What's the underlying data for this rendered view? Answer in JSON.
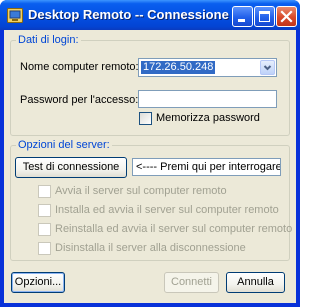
{
  "window": {
    "title": "Desktop Remoto -- Connessione",
    "app_icon": "remote-desktop-icon",
    "controls": [
      "minimize-icon",
      "maximize-icon",
      "close-icon"
    ]
  },
  "login": {
    "legend": "Dati di login:",
    "computer_label": "Nome computer remoto:",
    "computer_value": "172.26.50.248",
    "password_label": "Password per l'accesso:",
    "password_value": "",
    "remember_label": "Memorizza password",
    "remember_checked": false
  },
  "server": {
    "legend": "Opzioni del server:",
    "test_button": "Test di connessione",
    "hint_text": "<---- Premi qui per interrogare il server",
    "options": [
      {
        "label": "Avvia il server sul computer remoto",
        "checked": false,
        "enabled": false
      },
      {
        "label": "Installa ed avvia il server sul computer remoto",
        "checked": false,
        "enabled": false
      },
      {
        "label": "Reinstalla ed avvia il server sul computer remoto",
        "checked": false,
        "enabled": false
      },
      {
        "label": "Disinstalla il server alla disconnessione",
        "checked": false,
        "enabled": false
      }
    ]
  },
  "footer": {
    "options_button": "Opzioni...",
    "connect_button": "Connetti",
    "cancel_button": "Annulla"
  },
  "colors": {
    "titlebar": "#0451e3",
    "dialog_bg": "#ece9d8",
    "group_legend": "#0046d5",
    "selection": "#316ac5",
    "disabled_text": "#a1a192"
  }
}
